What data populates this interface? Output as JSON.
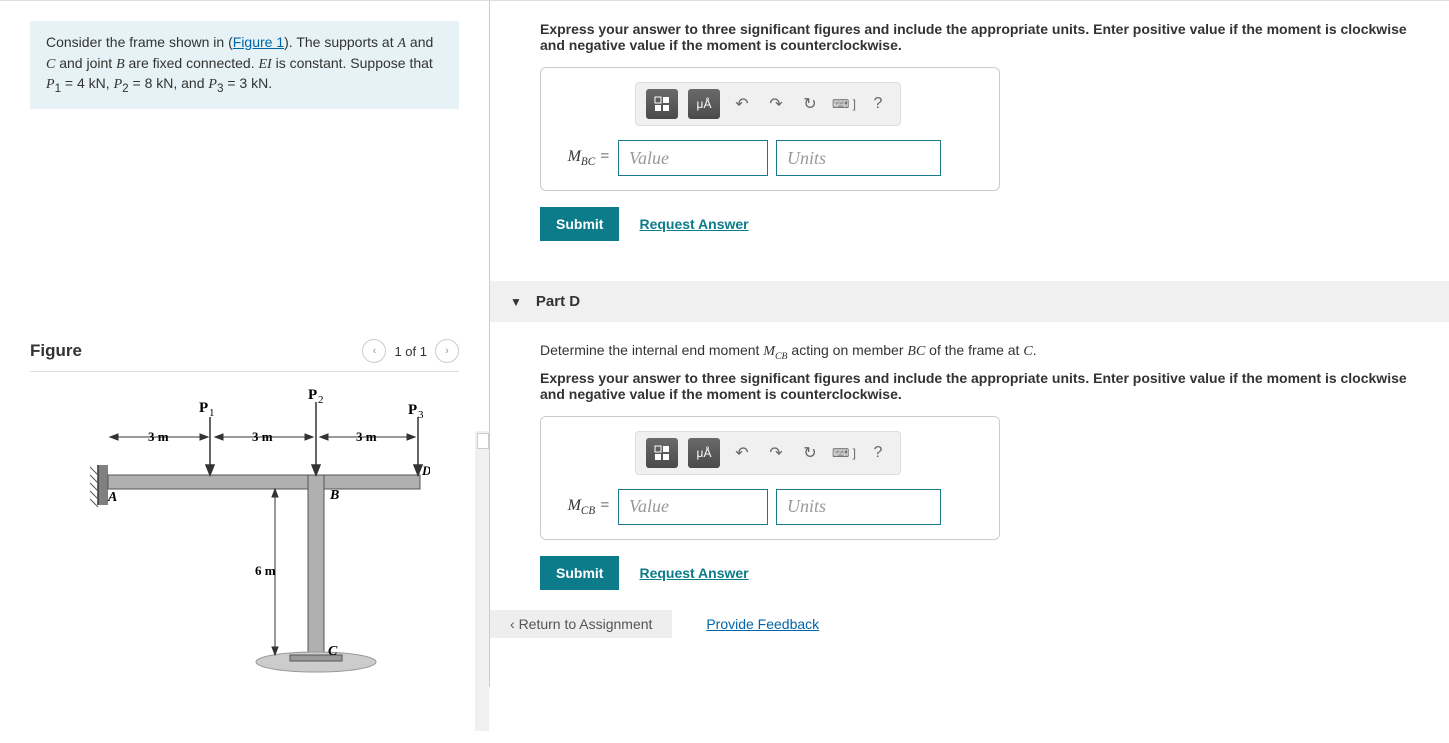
{
  "problem": {
    "text_full": "Consider the frame shown in (Figure 1). The supports at A and C and joint B are fixed connected. EI is constant. Suppose that P₁ = 4 kN, P₂ = 8 kN, and P₃ = 3 kN.",
    "figure_link": "Figure 1"
  },
  "figure": {
    "title": "Figure",
    "pager": "1 of 1",
    "nav_prev": "‹",
    "nav_next": "›",
    "labels": {
      "P1": "P₁",
      "P2": "P₂",
      "P3": "P₃",
      "A": "A",
      "B": "B",
      "C": "C",
      "D": "D",
      "d3m": "3 m",
      "d6m": "6 m"
    }
  },
  "toolbar": {
    "templates": "templates",
    "special_chars": "μÅ",
    "undo": "↶",
    "redo": "↷",
    "reset": "↻",
    "keyboard": "⌨ ]",
    "help": "?"
  },
  "partC": {
    "instruction": "Express your answer to three significant figures and include the appropriate units. Enter positive value if the moment is clockwise and negative value if the moment is counterclockwise.",
    "label_html": "M<sub>BC</sub> =",
    "label_prefix": "M",
    "label_sub": "BC",
    "label_suffix": " =",
    "value_placeholder": "Value",
    "units_placeholder": "Units",
    "submit": "Submit",
    "request": "Request Answer"
  },
  "partD": {
    "header": "Part D",
    "prompt_prefix": "Determine the internal end moment ",
    "prompt_m_sub": "CB",
    "prompt_mid": " acting on member ",
    "prompt_member": "BC",
    "prompt_suffix": " of the frame at ",
    "prompt_point": "C",
    "prompt_end": ".",
    "instruction": "Express your answer to three significant figures and include the appropriate units. Enter positive value if the moment is clockwise and negative value if the moment is counterclockwise.",
    "label_prefix": "M",
    "label_sub": "CB",
    "label_suffix": " =",
    "value_placeholder": "Value",
    "units_placeholder": "Units",
    "submit": "Submit",
    "request": "Request Answer"
  },
  "footer": {
    "return": "Return to Assignment",
    "feedback": "Provide Feedback"
  }
}
